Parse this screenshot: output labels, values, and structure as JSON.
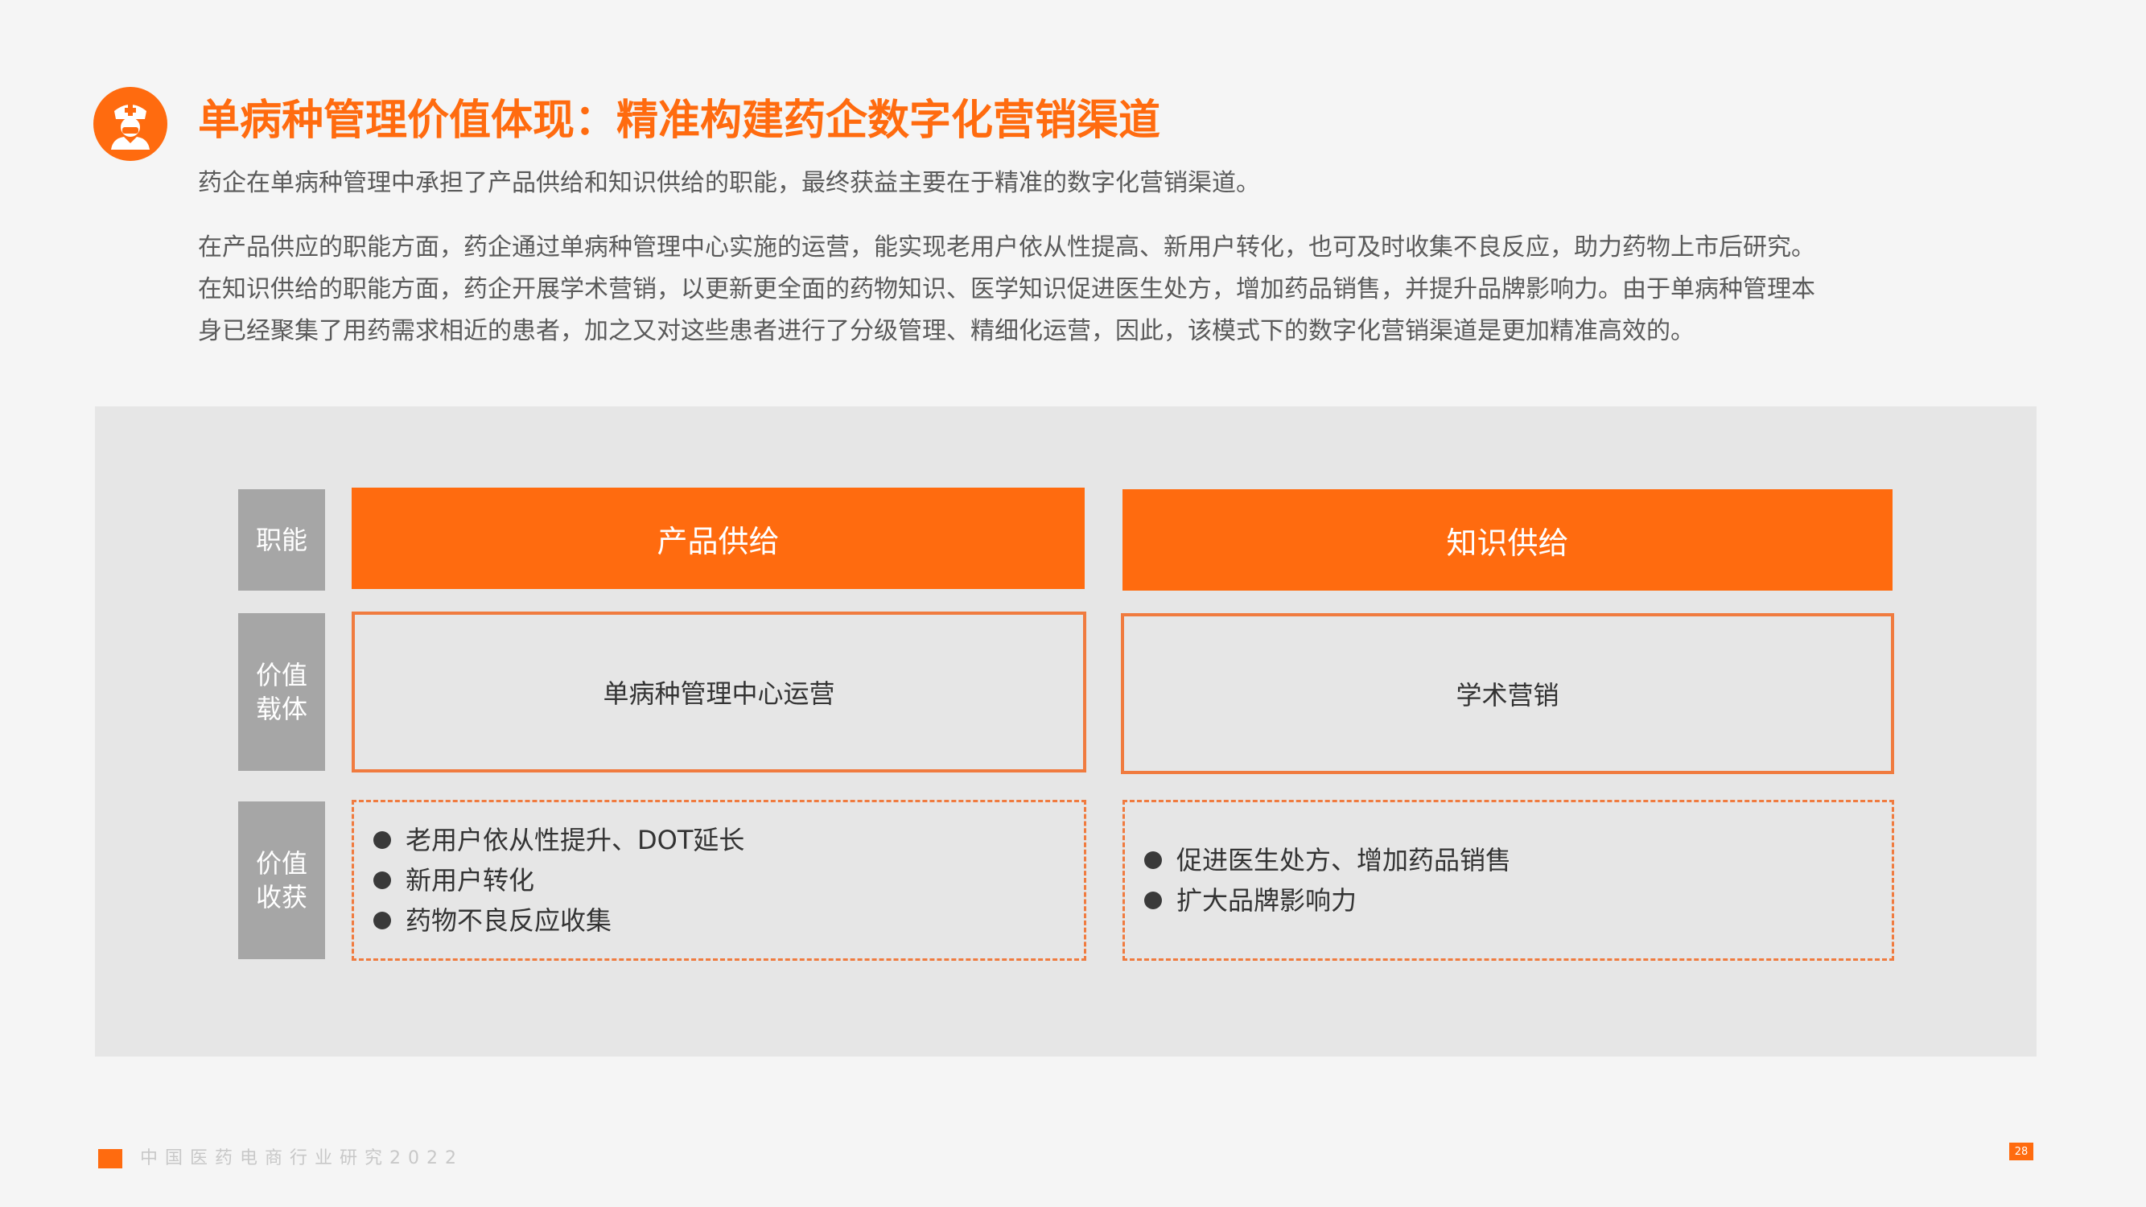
{
  "header": {
    "icon": "doctor-icon",
    "title": "单病种管理价值体现：精准构建药企数字化营销渠道",
    "subtitle": "药企在单病种管理中承担了产品供给和知识供给的职能，最终获益主要在于精准的数字化营销渠道。"
  },
  "paragraph": {
    "lines": [
      "在产品供应的职能方面，药企通过单病种管理中心实施的运营，能实现老用户依从性提高、新用户转化，也可及时收集不良反应，助力药物上市后研究。",
      "在知识供给的职能方面，药企开展学术营销，以更新更全面的药物知识、医学知识促进医生处方，增加药品销售，并提升品牌影响力。由于单病种管理本",
      "身已经聚集了用药需求相近的患者，加之又对这些患者进行了分级管理、精细化运营，因此，该模式下的数字化营销渠道是更加精准高效的。"
    ]
  },
  "table": {
    "row_labels": {
      "function": [
        "职能"
      ],
      "carrier": [
        "价值",
        "载体"
      ],
      "gain": [
        "价值",
        "收获"
      ]
    },
    "columns": [
      {
        "function": "产品供给",
        "carrier": "单病种管理中心运营",
        "gains": [
          "老用户依从性提升、DOT延长",
          "新用户转化",
          "药物不良反应收集"
        ]
      },
      {
        "function": "知识供给",
        "carrier": "学术营销",
        "gains": [
          "促进医生处方、增加药品销售",
          "扩大品牌影响力"
        ]
      }
    ]
  },
  "footer": {
    "text": "中国医药电商行业研究2022",
    "page_number": "28"
  },
  "colors": {
    "accent": "#ff6b0f",
    "label_gray": "#a6a6a6",
    "panel_bg": "#e6e6e6",
    "border_orange": "#f07b3f"
  }
}
